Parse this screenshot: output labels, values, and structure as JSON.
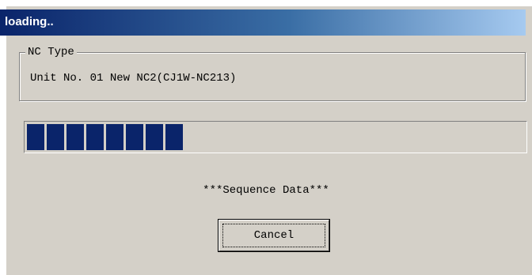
{
  "window": {
    "title": "loading.."
  },
  "nc_type": {
    "label": "NC Type",
    "value": "Unit No. 01 New NC2(CJ1W-NC213)"
  },
  "progress": {
    "filled_blocks": 8,
    "fraction": 0.33,
    "color": "#0a246a"
  },
  "status": {
    "text": "***Sequence Data***"
  },
  "buttons": {
    "cancel_label": "Cancel"
  },
  "colors": {
    "dialog_background": "#d4d0c8",
    "title_gradient_start": "#0a246a",
    "title_gradient_end": "#a6caf0"
  }
}
